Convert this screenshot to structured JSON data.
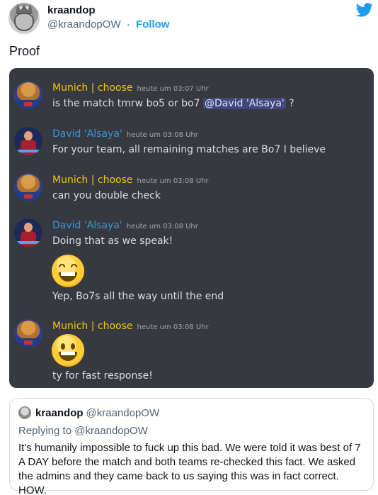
{
  "tweet": {
    "author_name": "kraandop",
    "author_handle": "@kraandopOW",
    "separator": "·",
    "follow_label": "Follow",
    "text": "Proof"
  },
  "discord": {
    "messages": [
      {
        "user": "Munich | choose",
        "timestamp": "heute um 03:07 Uhr",
        "text_before": "is the match tmrw bo5 or bo7 ",
        "mention": "@David 'Alsaya'",
        "text_after": " ?"
      },
      {
        "user": "David 'Alsaya'",
        "timestamp": "heute um 03:08 Uhr",
        "text": "For your team, all remaining matches are Bo7 I believe"
      },
      {
        "user": "Munich | choose",
        "timestamp": "heute um 03:08 Uhr",
        "text": "can you double check"
      },
      {
        "user": "David 'Alsaya'",
        "timestamp": "heute um 03:08 Uhr",
        "text": "Doing that as we speak!",
        "emoji": "grinning-squinting-face",
        "text2": "Yep, Bo7s all the way until the end"
      },
      {
        "user": "Munich | choose",
        "timestamp": "heute um 03:08 Uhr",
        "emoji": "grinning-face",
        "text": "ty for fast response!"
      }
    ],
    "colors": {
      "background": "#36393f",
      "munich": "#f1c40f",
      "david": "#3498db"
    }
  },
  "quote": {
    "author_name": "kraandop",
    "author_handle": "@kraandopOW",
    "replying_to": "Replying to @kraandopOW",
    "text": "It's humanily impossible to fuck up this bad. We were told it was best of 7 A DAY before the match and both teams re-checked this fact. We asked the admins and they came back to us saying this was in fact correct. HOW."
  }
}
